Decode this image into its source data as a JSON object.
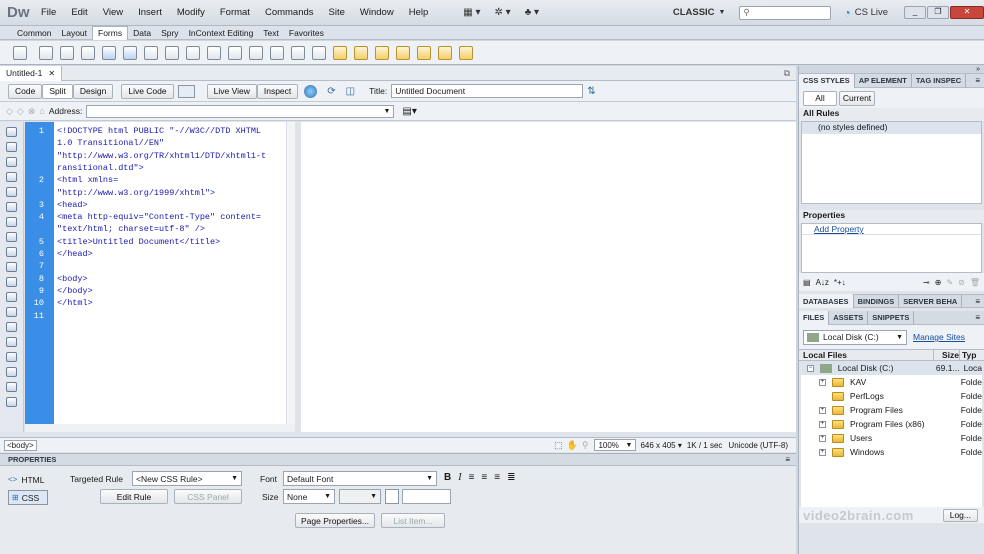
{
  "app": {
    "logo": "Dw",
    "menu": [
      "File",
      "Edit",
      "View",
      "Insert",
      "Modify",
      "Format",
      "Commands",
      "Site",
      "Window",
      "Help"
    ],
    "workspace": "CLASSIC",
    "search_placeholder": "",
    "cslive": "CS Live"
  },
  "insert_bar": {
    "tabs": [
      "Common",
      "Layout",
      "Forms",
      "Data",
      "Spry",
      "InContext Editing",
      "Text",
      "Favorites"
    ],
    "active": "Forms"
  },
  "doc": {
    "tab": "Untitled-1",
    "title_label": "Title:",
    "title_value": "Untitled Document",
    "address_label": "Address:"
  },
  "doc_toolbar": {
    "code": "Code",
    "split": "Split",
    "design": "Design",
    "live_code": "Live Code",
    "live_view": "Live View",
    "inspect": "Inspect"
  },
  "code": {
    "line_numbers": [
      "1",
      "2",
      "3",
      "4",
      "5",
      "6",
      "7",
      "8",
      "9",
      "10",
      "11"
    ],
    "lines": [
      "<!DOCTYPE html PUBLIC \"-//W3C//DTD XHTML",
      "1.0 Transitional//EN\"",
      "\"http://www.w3.org/TR/xhtml1/DTD/xhtml1-t",
      "ransitional.dtd\">",
      "<html xmlns=",
      "\"http://www.w3.org/1999/xhtml\">",
      "<head>",
      "<meta http-equiv=\"Content-Type\" content=",
      "\"text/html; charset=utf-8\" />",
      "<title>Untitled Document</title>",
      "</head>",
      "",
      "<body>",
      "</body>",
      "</html>"
    ]
  },
  "status": {
    "tag": "<body>",
    "zoom": "100%",
    "size": "646 x 405",
    "download": "1K / 1 sec",
    "encoding": "Unicode (UTF-8)"
  },
  "properties": {
    "title": "PROPERTIES",
    "html": "HTML",
    "css": "CSS",
    "targeted_rule_label": "Targeted Rule",
    "targeted_rule_value": "<New CSS Rule>",
    "font_label": "Font",
    "font_value": "Default Font",
    "edit_rule": "Edit Rule",
    "css_panel": "CSS Panel",
    "size_label": "Size",
    "size_value": "None",
    "page_properties": "Page Properties...",
    "list_item": "List Item..."
  },
  "css_panel": {
    "tabs": [
      "CSS STYLES",
      "AP ELEMENT",
      "TAG INSPEC"
    ],
    "all": "All",
    "current": "Current",
    "all_rules": "All Rules",
    "no_styles": "(no styles defined)",
    "properties": "Properties",
    "add_property": "Add Property"
  },
  "db_panel": {
    "tabs": [
      "DATABASES",
      "BINDINGS",
      "SERVER BEHA"
    ]
  },
  "files_panel": {
    "tabs": [
      "FILES",
      "ASSETS",
      "SNIPPETS"
    ],
    "drive": "Local Disk (C:)",
    "manage_sites": "Manage Sites",
    "col_local": "Local Files",
    "col_size": "Size",
    "col_type": "Typ",
    "root": {
      "name": "Local Disk (C:)",
      "size": "69.1...",
      "type": "Loca"
    },
    "items": [
      {
        "name": "KAV",
        "type": "Folde",
        "expandable": true
      },
      {
        "name": "PerfLogs",
        "type": "Folde",
        "expandable": false
      },
      {
        "name": "Program Files",
        "type": "Folde",
        "expandable": true
      },
      {
        "name": "Program Files (x86)",
        "type": "Folde",
        "expandable": true
      },
      {
        "name": "Users",
        "type": "Folde",
        "expandable": true
      },
      {
        "name": "Windows",
        "type": "Folde",
        "expandable": true
      }
    ],
    "log": "Log..."
  },
  "watermark": "video2brain.com",
  "colors": {
    "accent": "#2f7fd0",
    "gutter": "#3a8ee6",
    "code": "#1a1ab0"
  }
}
